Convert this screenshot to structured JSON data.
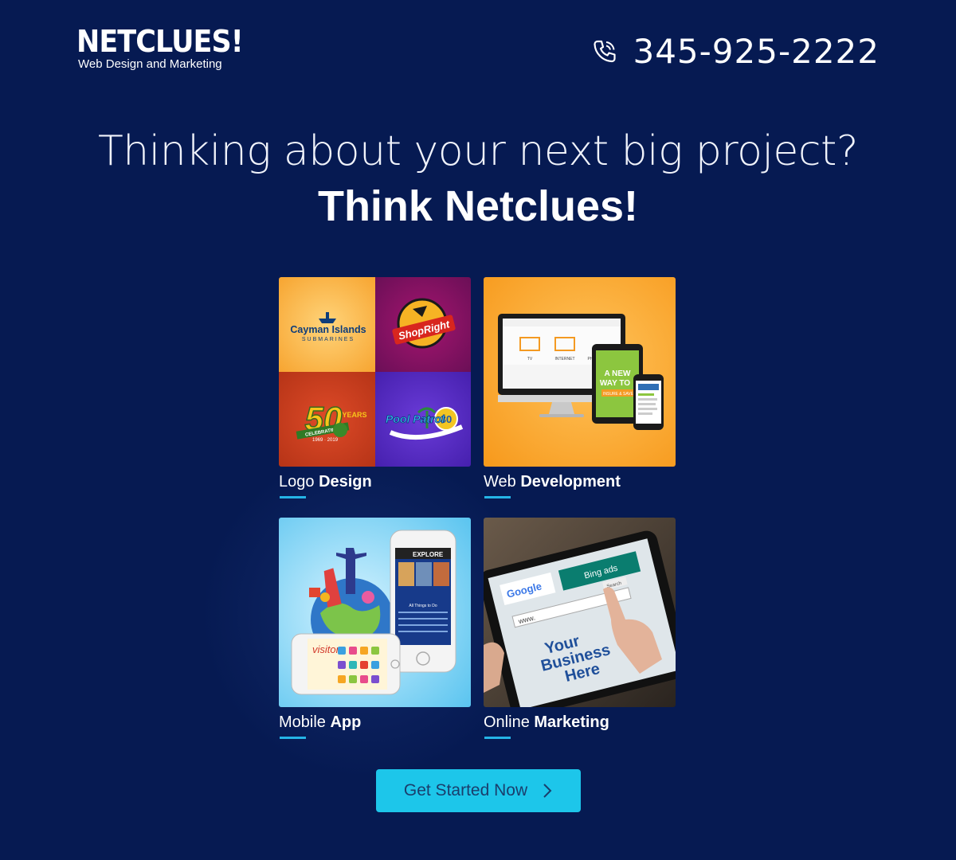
{
  "header": {
    "logo_name": "NETCLUES!",
    "logo_tagline": "Web Design and Marketing",
    "phone_icon": "phone-icon",
    "phone_number": "345-925-2222"
  },
  "headline": {
    "line1": "Thinking about your next big project?",
    "line2": "Think Netclues!"
  },
  "services": [
    {
      "light": "Logo",
      "bold": "Design",
      "icon": "logo-design-image"
    },
    {
      "light": "Web",
      "bold": "Development",
      "icon": "web-development-image"
    },
    {
      "light": "Mobile",
      "bold": "App",
      "icon": "mobile-app-image"
    },
    {
      "light": "Online",
      "bold": "Marketing",
      "icon": "online-marketing-image"
    }
  ],
  "logo_tiles": {
    "cayman": "Cayman Islands",
    "cayman_sub": "SUBMARINES",
    "shopright": "ShopRight",
    "fifty": "50",
    "years": "YEARS",
    "celebrating": "CELEBRATING",
    "years_range": "1969 · 2019",
    "pool": "Pool Patrol",
    "thirty": "30"
  },
  "web_dev_tile": {
    "tablet_text_1": "A NEW",
    "tablet_text_2": "WAY TO",
    "tablet_text_3": "INSURE & SAVE",
    "monitor_labels": [
      "TV",
      "INTERNET",
      "PH"
    ]
  },
  "mobile_tile": {
    "explore": "EXPLORE",
    "things": "All Things to Do",
    "visitor": "visitor"
  },
  "marketing_tile": {
    "google": "Google",
    "bing": "Bing ads",
    "www": "www.",
    "search": "Search",
    "business_1": "Your",
    "business_2": "Business",
    "business_3": "Here"
  },
  "cta": {
    "label": "Get Started Now",
    "icon": "chevron-right-icon"
  },
  "colors": {
    "background": "#061a52",
    "accent": "#1dc6ea",
    "underline": "#25b4e6"
  }
}
